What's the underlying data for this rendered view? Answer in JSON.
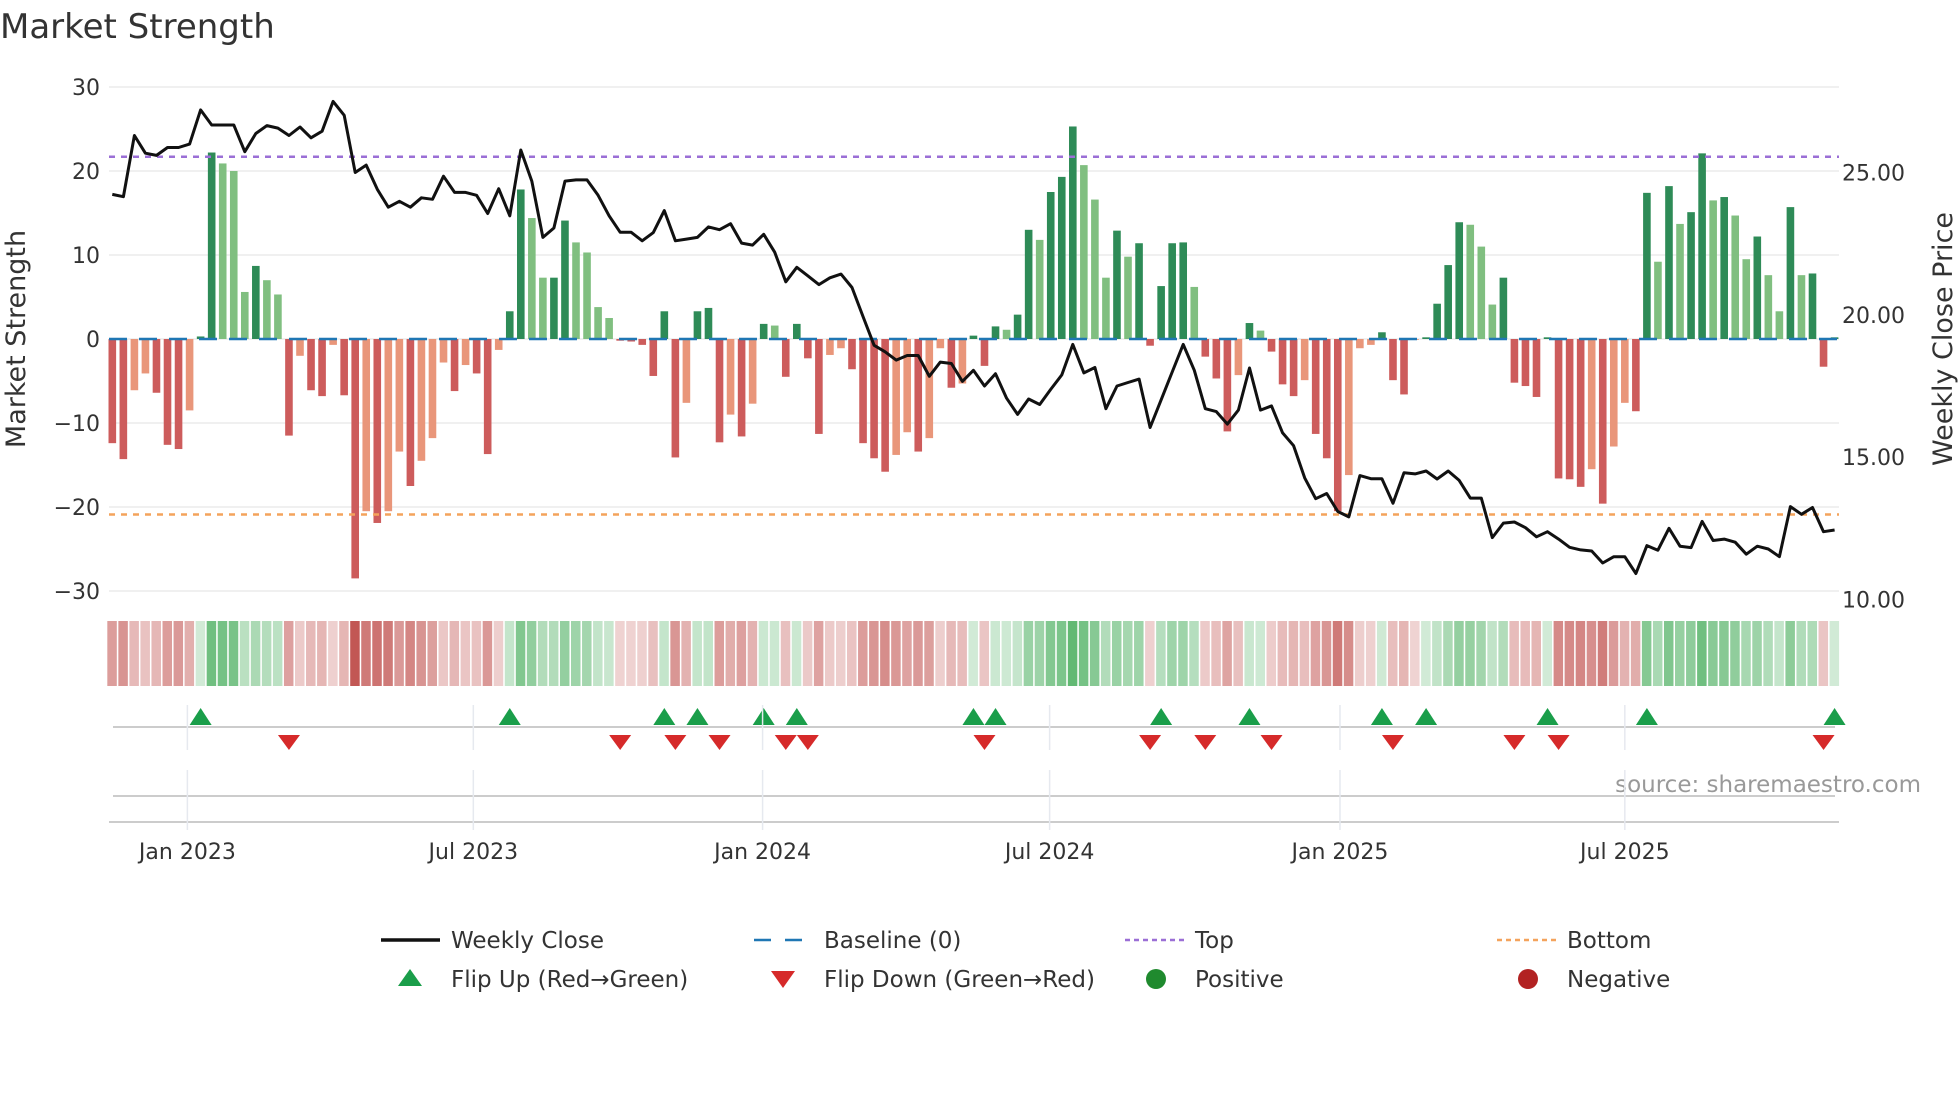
{
  "chart_data": {
    "type": "bar",
    "title": "Market Strength",
    "ylabel": "Market Strength",
    "y2label": "Weekly Close Price",
    "source": "source: sharemaestro.com",
    "ylim": [
      -31,
      31
    ],
    "y2lim": [
      10,
      28.3
    ],
    "yticks": [
      30,
      20,
      10,
      0,
      -10,
      -20,
      -30
    ],
    "yticklabels": [
      "30",
      "20",
      "10",
      "0",
      "−10",
      "−20",
      "−30"
    ],
    "y2ticks": [
      25,
      20,
      15,
      10
    ],
    "y2ticklabels": [
      "25.00",
      "20.00",
      "15.00",
      "10.00"
    ],
    "xlim": [
      -0.3,
      156.4
    ],
    "xticks": [
      6.8,
      32.7,
      58.9,
      84.9,
      111.2,
      137.0
    ],
    "xticklabels": [
      "Jan 2023",
      "Jul 2023",
      "Jan 2024",
      "Jul 2024",
      "Jan 2025",
      "Jul 2025"
    ],
    "top_level": 21.7,
    "bottom_level": -20.9,
    "strength": [
      -12.4,
      -14.3,
      -6.1,
      -4.1,
      -6.4,
      -12.6,
      -13.1,
      -8.5,
      0.3,
      22.2,
      20.9,
      20.0,
      5.6,
      8.7,
      7.0,
      5.3,
      -11.5,
      -2.0,
      -6.1,
      -6.8,
      -0.7,
      -6.7,
      -28.5,
      -20.5,
      -21.9,
      -20.5,
      -13.4,
      -17.5,
      -14.5,
      -11.8,
      -2.8,
      -6.2,
      -3.1,
      -4.1,
      -13.7,
      -1.3,
      3.3,
      17.8,
      14.4,
      7.3,
      7.3,
      14.1,
      11.5,
      10.3,
      3.8,
      2.5,
      -0.2,
      -0.3,
      -0.7,
      -4.4,
      3.3,
      -14.1,
      -7.6,
      3.3,
      3.7,
      -12.3,
      -9.0,
      -11.6,
      -7.7,
      1.8,
      1.6,
      -4.5,
      1.8,
      -2.3,
      -11.3,
      -1.9,
      -1.1,
      -3.6,
      -12.4,
      -14.2,
      -15.8,
      -13.8,
      -11.1,
      -13.4,
      -11.8,
      -1.1,
      -5.8,
      -5.3,
      0.4,
      -3.2,
      1.5,
      1.1,
      2.9,
      13.0,
      11.8,
      17.5,
      19.3,
      25.3,
      20.7,
      16.6,
      7.3,
      12.9,
      9.8,
      11.4,
      -0.8,
      6.3,
      11.4,
      11.5,
      6.2,
      -2.1,
      -4.7,
      -11.0,
      -4.3,
      1.9,
      1.0,
      -1.5,
      -5.4,
      -6.8,
      -4.9,
      -11.3,
      -14.2,
      -20.5,
      -16.2,
      -1.1,
      -0.7,
      0.8,
      -4.9,
      -6.6,
      -0.1,
      0.2,
      4.2,
      8.8,
      13.9,
      13.6,
      11.0,
      4.1,
      7.3,
      -5.2,
      -5.6,
      -6.9,
      0.2,
      -16.6,
      -16.7,
      -17.6,
      -15.5,
      -19.6,
      -12.8,
      -7.6,
      -8.6,
      17.4,
      9.2,
      18.2,
      13.7,
      15.1,
      22.1,
      16.5,
      16.9,
      14.7,
      9.5,
      12.2,
      7.6,
      3.3,
      15.7,
      7.6,
      7.8,
      -3.3,
      0.2
    ],
    "weekly_close": [
      24.23,
      24.15,
      26.3,
      25.68,
      25.6,
      25.88,
      25.88,
      26.0,
      27.2,
      26.67,
      26.67,
      26.67,
      25.73,
      26.37,
      26.65,
      26.56,
      26.3,
      26.6,
      26.22,
      26.45,
      27.5,
      27.01,
      25.0,
      25.26,
      24.41,
      23.78,
      23.99,
      23.78,
      24.11,
      24.06,
      24.87,
      24.3,
      24.3,
      24.2,
      23.56,
      24.43,
      23.48,
      25.79,
      24.7,
      22.72,
      23.05,
      24.7,
      24.74,
      24.74,
      24.2,
      23.48,
      22.9,
      22.9,
      22.6,
      22.89,
      23.66,
      22.6,
      22.66,
      22.72,
      23.09,
      22.99,
      23.2,
      22.52,
      22.45,
      22.83,
      22.2,
      21.16,
      21.67,
      21.37,
      21.06,
      21.3,
      21.43,
      20.96,
      19.94,
      18.93,
      18.7,
      18.41,
      18.57,
      18.57,
      17.84,
      18.34,
      18.29,
      17.66,
      18.05,
      17.5,
      17.93,
      17.07,
      16.5,
      17.04,
      16.85,
      17.38,
      17.89,
      18.96,
      17.96,
      18.15,
      16.7,
      17.5,
      17.62,
      17.74,
      16.04,
      17.01,
      17.99,
      18.96,
      18.05,
      16.7,
      16.6,
      16.16,
      16.65,
      18.13,
      16.65,
      16.8,
      15.85,
      15.4,
      14.27,
      13.54,
      13.72,
      13.09,
      12.9,
      14.35,
      14.24,
      14.24,
      13.38,
      14.45,
      14.41,
      14.51,
      14.23,
      14.51,
      14.18,
      13.56,
      13.56,
      12.17,
      12.68,
      12.72,
      12.52,
      12.2,
      12.38,
      12.12,
      11.83,
      11.74,
      11.7,
      11.28,
      11.5,
      11.5,
      10.91,
      11.89,
      11.73,
      12.5,
      11.87,
      11.82,
      12.74,
      12.07,
      12.12,
      12.01,
      11.59,
      11.87,
      11.77,
      11.5,
      13.26,
      12.99,
      13.23,
      12.38,
      12.44
    ],
    "legend": {
      "placement": "bottom",
      "items": [
        {
          "label": "Weekly Close",
          "kind": "line",
          "color": "#111111"
        },
        {
          "label": "Baseline (0)",
          "kind": "dash",
          "color": "#1f77b4"
        },
        {
          "label": "Top",
          "kind": "dot",
          "color": "#9b6fd6"
        },
        {
          "label": "Bottom",
          "kind": "dot",
          "color": "#f4a35c"
        },
        {
          "label": "Flip Up (Red→Green)",
          "kind": "up",
          "color": "#1a9e4a"
        },
        {
          "label": "Flip Down (Green→Red)",
          "kind": "down",
          "color": "#d62a2a"
        },
        {
          "label": "Positive",
          "kind": "dot-circle",
          "color": "#1f8a2e"
        },
        {
          "label": "Negative",
          "kind": "dot-circle",
          "color": "#b22222"
        }
      ]
    },
    "colors": {
      "pos_dark": "#2e8b57",
      "pos_light": "#80bf80",
      "neg_dark": "#cd5c5c",
      "neg_light": "#e9967a",
      "baseline": "#1f77b4",
      "top": "#9b6fd6",
      "bottom": "#f4a35c",
      "flip_up": "#1a9e4a",
      "flip_down": "#d62a2a",
      "grid": "#ececec"
    }
  }
}
